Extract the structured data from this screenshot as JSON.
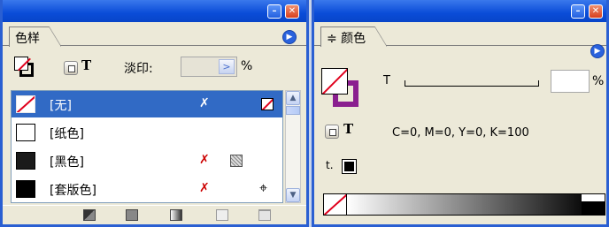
{
  "swatches_panel": {
    "tab_label": "色样",
    "tint_label": "淡印:",
    "tint_value": "",
    "tint_unit": "%",
    "rows": [
      {
        "name": "[无]",
        "selected": true,
        "chip_color": "none"
      },
      {
        "name": "[纸色]",
        "selected": false,
        "chip_color": "#ffffff"
      },
      {
        "name": "[黑色]",
        "selected": false,
        "chip_color": "#1a1a1a"
      },
      {
        "name": "[套版色]",
        "selected": false,
        "chip_color": "#000000"
      }
    ],
    "text_format_icon": "T",
    "menu_glyph": "▶"
  },
  "color_panel": {
    "tab_label": "≑ 颜色",
    "tint_letter": "T",
    "tint_value": "",
    "tint_unit": "%",
    "cmyk_readout": "C=0,  M=0,  Y=0,  K=100",
    "text_format_icon": "T",
    "toggle_label": "t.",
    "stroke_color": "#8a1f8f",
    "menu_glyph": "▶"
  },
  "colors": {
    "title_bar": "#0a4cd8",
    "selection": "#316ac5",
    "none_red": "#e0001c"
  }
}
